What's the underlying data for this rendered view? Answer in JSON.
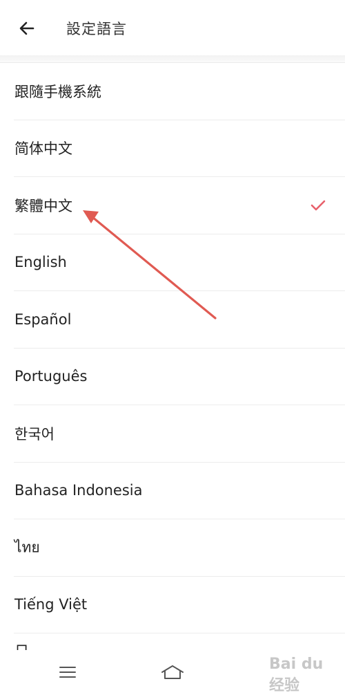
{
  "header": {
    "back_icon": "arrow-left-icon",
    "title": "設定語言"
  },
  "languages": [
    {
      "label": "跟隨手機系統",
      "selected": false
    },
    {
      "label": "简体中文",
      "selected": false
    },
    {
      "label": "繁體中文",
      "selected": true
    },
    {
      "label": "English",
      "selected": false
    },
    {
      "label": "Español",
      "selected": false
    },
    {
      "label": "Português",
      "selected": false
    },
    {
      "label": "한국어",
      "selected": false
    },
    {
      "label": "Bahasa Indonesia",
      "selected": false
    },
    {
      "label": "ไทย",
      "selected": false
    },
    {
      "label": "Tiếng Việt",
      "selected": false
    }
  ],
  "partial_item": "日本",
  "colors": {
    "check": "#e8606b",
    "annotation_arrow": "#e05a52"
  },
  "navbar": {
    "menu_icon": "menu-icon",
    "home_icon": "home-icon"
  },
  "watermark": "Bai du 经验"
}
